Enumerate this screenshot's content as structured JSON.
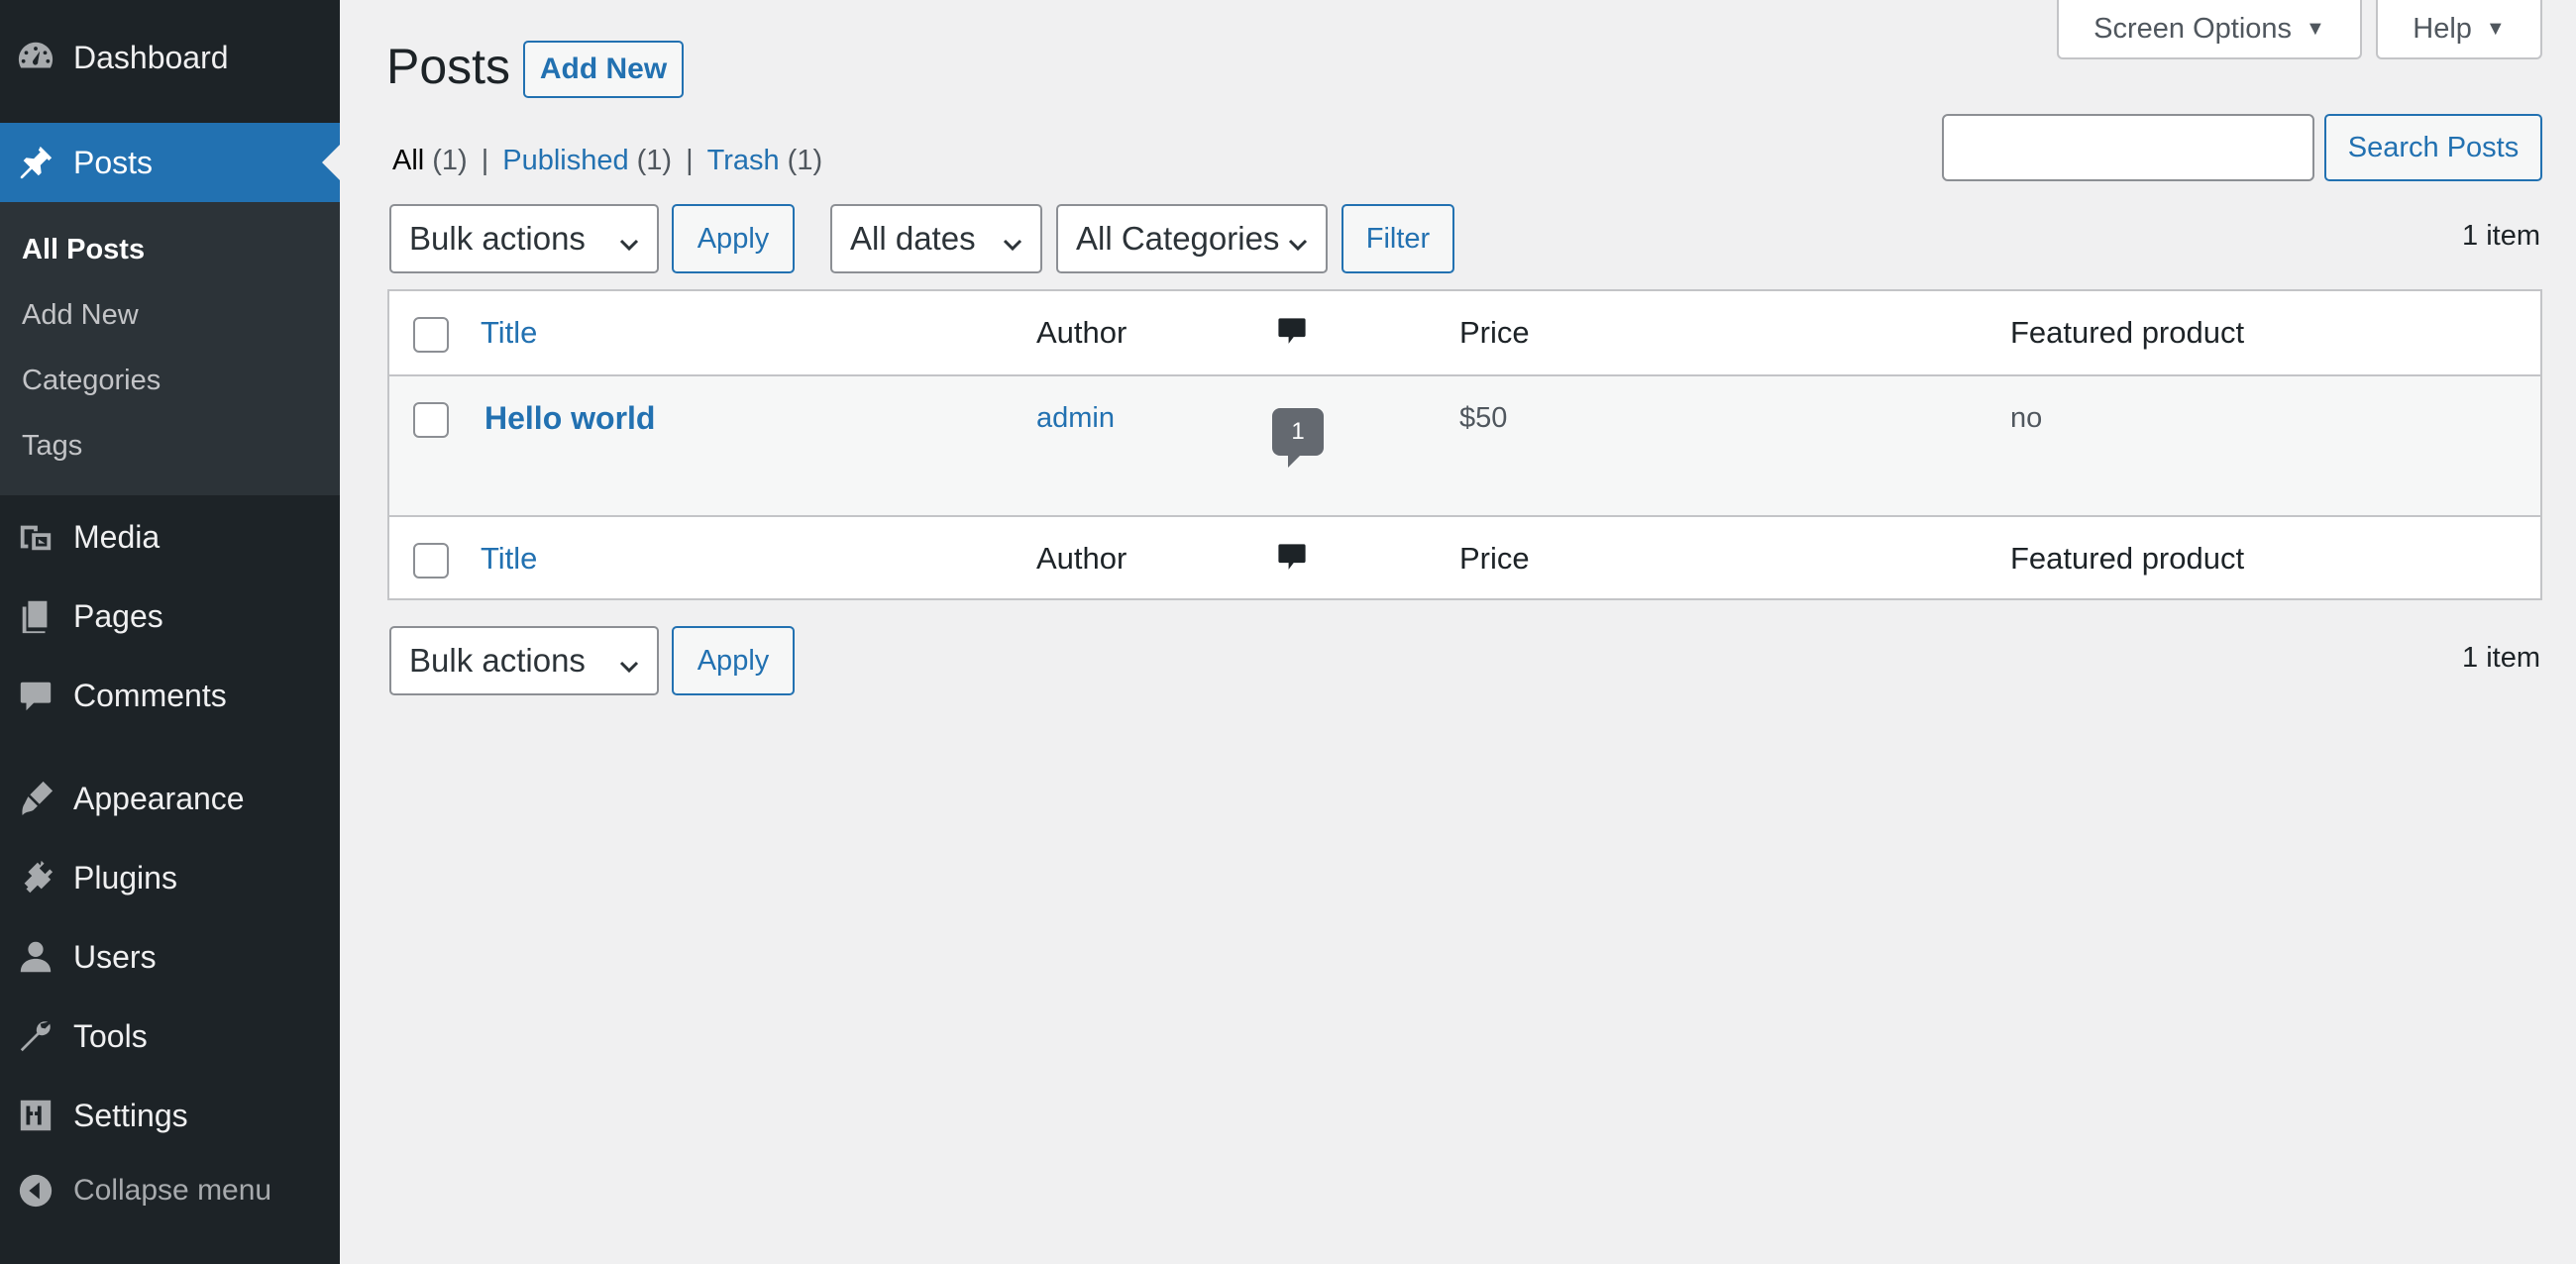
{
  "sidebar": {
    "items": [
      {
        "label": "Dashboard",
        "icon": "dashboard-icon"
      },
      {
        "label": "Posts",
        "icon": "pin-icon",
        "active": true
      },
      {
        "label": "Media",
        "icon": "media-icon"
      },
      {
        "label": "Pages",
        "icon": "pages-icon"
      },
      {
        "label": "Comments",
        "icon": "comment-icon"
      },
      {
        "label": "Appearance",
        "icon": "brush-icon"
      },
      {
        "label": "Plugins",
        "icon": "plug-icon"
      },
      {
        "label": "Users",
        "icon": "user-icon"
      },
      {
        "label": "Tools",
        "icon": "wrench-icon"
      },
      {
        "label": "Settings",
        "icon": "settings-icon"
      }
    ],
    "submenu": [
      {
        "label": "All Posts",
        "current": true
      },
      {
        "label": "Add New"
      },
      {
        "label": "Categories"
      },
      {
        "label": "Tags"
      }
    ],
    "collapse_label": "Collapse menu"
  },
  "header": {
    "title": "Posts",
    "add_new": "Add New",
    "screen_options": "Screen Options",
    "help": "Help"
  },
  "views": {
    "all": "All",
    "all_count": "(1)",
    "published": "Published",
    "published_count": "(1)",
    "trash": "Trash",
    "trash_count": "(1)",
    "separator": "|"
  },
  "search": {
    "value": "",
    "button": "Search Posts"
  },
  "tablenav": {
    "bulk_actions": "Bulk actions",
    "apply": "Apply",
    "dates": "All dates",
    "categories": "All Categories",
    "filter": "Filter",
    "count": "1 item"
  },
  "table": {
    "columns": {
      "title": "Title",
      "author": "Author",
      "price": "Price",
      "featured": "Featured product"
    },
    "rows": [
      {
        "title": "Hello world",
        "author": "admin",
        "comments": "1",
        "price": "$50",
        "featured": "no"
      }
    ]
  },
  "colors": {
    "sidebar_bg": "#1d2327",
    "accent": "#2271b1",
    "page_bg": "#f0f0f1"
  }
}
